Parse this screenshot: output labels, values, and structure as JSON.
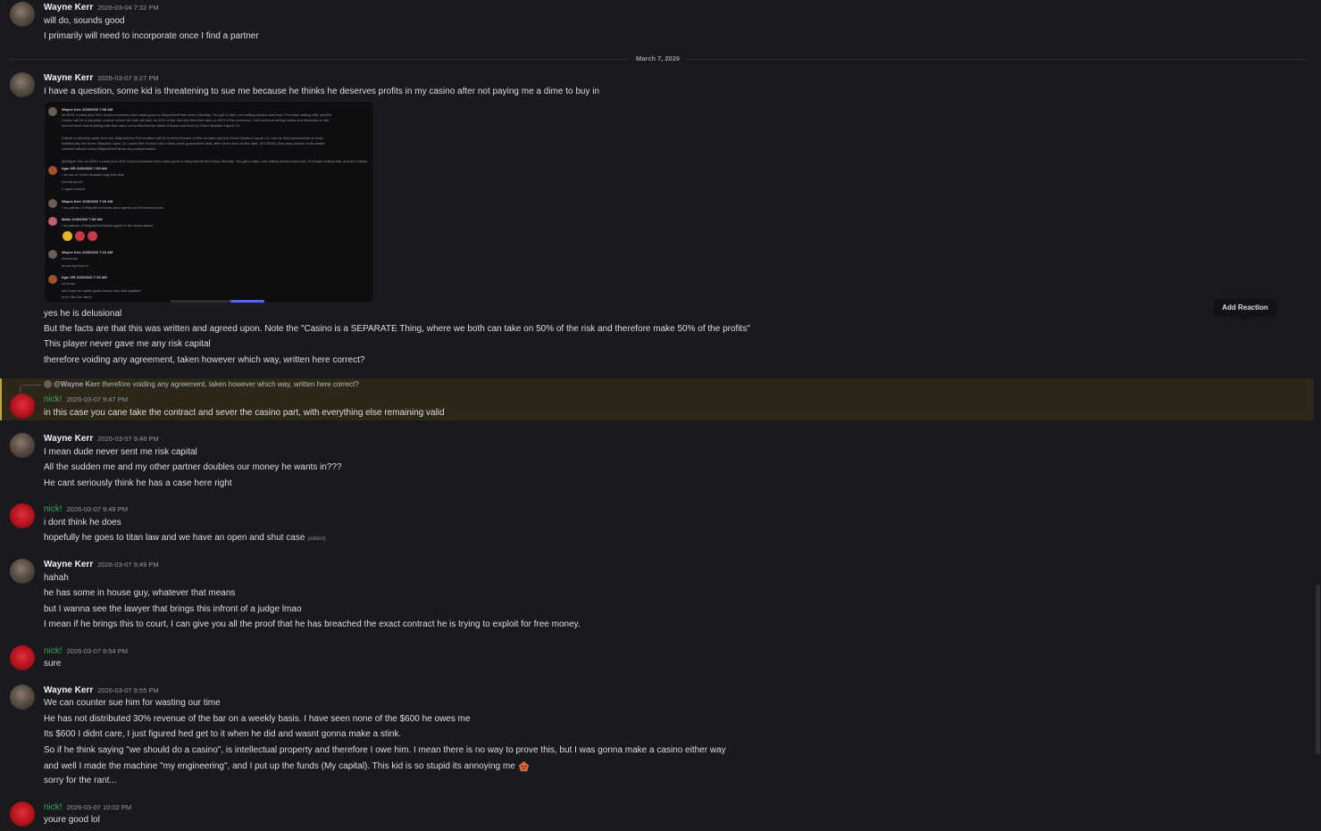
{
  "divider": {
    "label": "March 7, 2026"
  },
  "tooltip": {
    "label": "Add Reaction"
  },
  "messages": {
    "m1": {
      "author": "Wayne Kerr",
      "timestamp": "2026-03-04 7:32 PM",
      "lines": [
        "will do, sounds good",
        "I primarily will need to incorporate once I find a partner"
      ]
    },
    "m2": {
      "author": "Wayne Kerr",
      "timestamp": "2026-03-07 9:27 PM",
      "lines": [
        "I have a question, some kid is threatening to sue me because he thinks he deserves profits in my casino after not paying me a dime to buy in"
      ],
      "lines_after": [
        "yes he is delusional",
        "But the facts are that this was written and agreed upon. Note the \"Casino is a SEPARATE Thing, where we both can take on 50% of the risk and therefore make 50% of the profits\"",
        "This player never gave me any risk capital",
        "therefore voiding any agreement, taken however which way, written here correct?"
      ]
    },
    "m3": {
      "reply_author": "@Wayne Kerr",
      "reply_text": "therefore voiding any agreement, taken however which way, written here correct?",
      "author": "nick!",
      "timestamp": "2026-03-07 9:47 PM",
      "lines": [
        "in this case you cane take the contract and sever the casino part, with everything else remaining valid"
      ]
    },
    "m4": {
      "author": "Wayne Kerr",
      "timestamp": "2026-03-07 9:48 PM",
      "lines": [
        "I mean dude never sent me risk capital",
        "All the sudden me and my other partner doubles our money he wants in???",
        "He cant seriously think he has a case here right"
      ]
    },
    "m5": {
      "author": "nick!",
      "timestamp": "2026-03-07 9:49 PM",
      "lines": [
        "i dont think he does",
        "hopefully he goes to titan law and we have an open and shut case"
      ],
      "edited": "(edited)"
    },
    "m6": {
      "author": "Wayne Kerr",
      "timestamp": "2026-03-07 9:49 PM",
      "lines": [
        "hahah",
        "he has some in house guy, whatever that means",
        "but I wanna see the lawyer that brings this infront of a judge lmao",
        "I mean if he brings this to court, I can give you all the proof that he has breached the exact contract he is trying to exploit for free money."
      ]
    },
    "m7": {
      "author": "nick!",
      "timestamp": "2026-03-07 9:54 PM",
      "lines": [
        "sure"
      ]
    },
    "m8": {
      "author": "Wayne Kerr",
      "timestamp": "2026-03-07 9:55 PM",
      "lines": [
        "We can counter sue him for wasting our time",
        "He has not distributed 30% revenue of the bar on a weekly basis. I have seen none of the $600 he owes me",
        "Its $600 I didnt care, I just figured hed get to it when he did and wasnt gonna make a stink.",
        "So if he think saying \"we should do a casino\", is intellectual property and therefore I owe him. I mean there is no way to prove this, but I was gonna make a casino either way",
        "and well I made the machine \"my engineering\", and I put up the funds (My capital). This kid is so stupid its annoying me",
        "sorry for the rant..."
      ]
    },
    "m9": {
      "author": "nick!",
      "timestamp": "2026-03-07 10:02 PM",
      "lines": [
        "youre good lol"
      ]
    }
  },
  "attachment": {
    "lines": [
      "Wayne Kerr 2/28/2026 7:08 AM",
      "as $200 a week plus 30% of your revenues from sales goes to WayneKerrFarm every Monday. You get to take over selling alcohol and food. I'll remain selling milk, and the",
      "Casino will be a separate venture where we both will take on 50% of the risk and therefore take on 50% of the revenues. I will continue selling books and fireworks on the",
      "second level and anything else that does not undermind the sales of liquor and food by Green Bastard Liquor Co.",
      "Failure to disclose sales from the WayneKerrs Pub location will be in direct breach of this contract and the Green Bastard Liquor Co. can be held accountable in court.",
      "Additionally the Green Bastard Liquor Co. would like to back into a three week guaranteed deal, after which time on the date, (3/7/2026), they may choose to terminate",
      "contract without owing WayneKerrFarms any compensation.",
      "@Wayne Kerr as $200 a week plus 30% of your revenues from sales goes to WayneKerrFarm every Monday. You get to take over selling alcohol and food. I'll remain selling milk, and the Casino",
      "tiger HR 2/28/2026 7:09 AM",
      "I as ceo of Green Bastard sign this deal",
      "sounds good",
      "u agree aswell",
      "Wayne Kerr 2/28/2026 7:09 AM",
      "I as partner of WayneKerrFarms also agrees to the terms above!",
      "Mads 2/28/2026 7:09 AM",
      "I as partner of WayneKerrFarms agree to the terms above",
      "Wayne Kerr 2/28/2026 7:10 AM",
      "Wonderful",
      "Imma log back in",
      "tiger HR 2/28/2026 7:10 AM",
      "vlr show",
      "lets hope we make good money from this together",
      "and I like the name"
    ]
  },
  "colors": {
    "background": "#1a1a1e",
    "accent_highlight": "#c6a23c",
    "nick_name": "#3ba55c",
    "timestamp": "#949ba4"
  }
}
